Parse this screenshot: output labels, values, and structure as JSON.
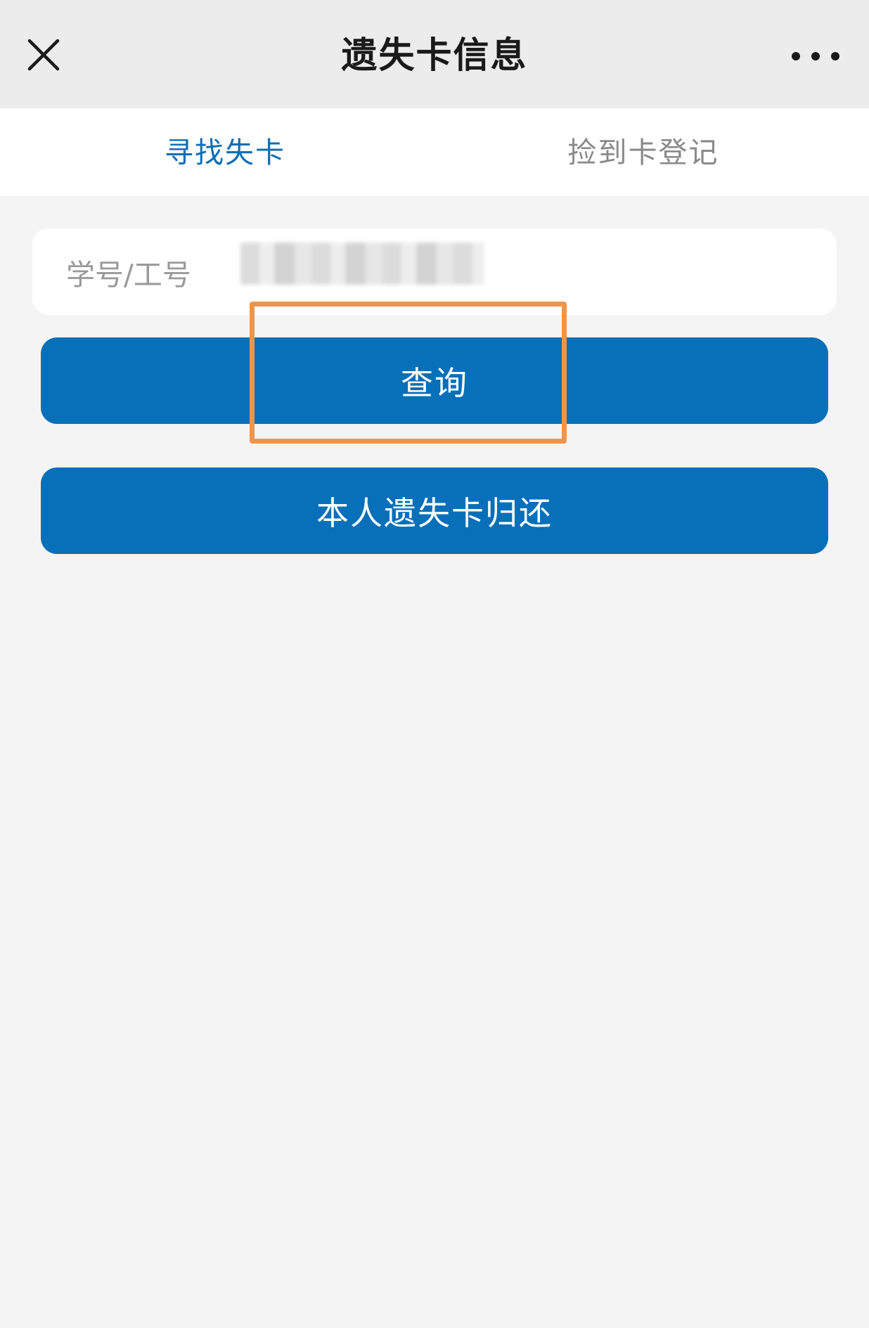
{
  "navbar": {
    "title": "遗失卡信息",
    "close_icon": "close-icon",
    "more_icon": "more-dots-icon"
  },
  "tabs": [
    {
      "label": "寻找失卡",
      "active": true
    },
    {
      "label": "捡到卡登记",
      "active": false
    }
  ],
  "form": {
    "id_label": "学号/工号",
    "id_value": ""
  },
  "buttons": {
    "query": "查询",
    "return_own": "本人遗失卡归还"
  },
  "colors": {
    "primary": "#0770b8",
    "tab_active": "#0d6fb4",
    "tab_inactive": "#8a8a8a",
    "highlight": "#ef9549",
    "background": "#f4f4f4"
  }
}
